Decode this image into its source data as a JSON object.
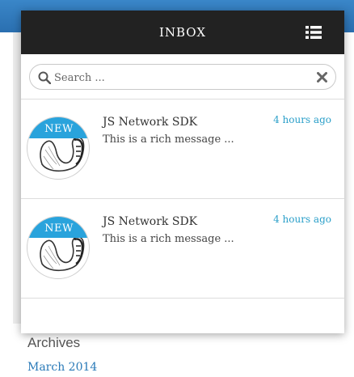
{
  "inbox": {
    "title": "INBOX",
    "search": {
      "placeholder": "Search ..."
    },
    "messages": [
      {
        "badge": "NEW",
        "title": "JS Network SDK",
        "body": "This is a rich message ...",
        "time": "4 hours ago"
      },
      {
        "badge": "NEW",
        "title": "JS Network SDK",
        "body": "This is a rich message ...",
        "time": "4 hours ago"
      }
    ]
  },
  "background": {
    "archives_title": "Archives",
    "archives_link": "March 2014"
  },
  "colors": {
    "header_bg": "#222222",
    "badge_bg": "#29a3dc",
    "time_text": "#2a9fc9"
  }
}
